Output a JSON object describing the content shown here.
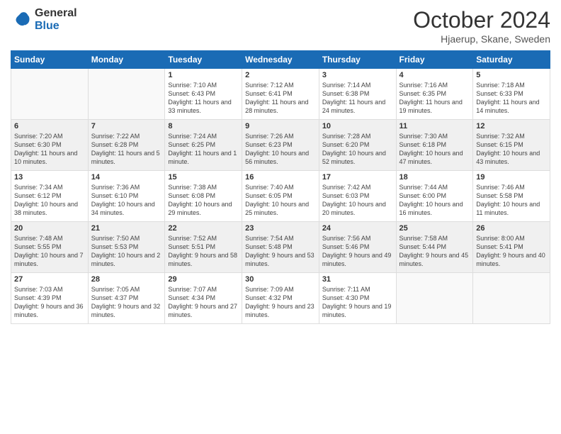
{
  "logo": {
    "general": "General",
    "blue": "Blue"
  },
  "title": "October 2024",
  "location": "Hjaerup, Skane, Sweden",
  "days": [
    "Sunday",
    "Monday",
    "Tuesday",
    "Wednesday",
    "Thursday",
    "Friday",
    "Saturday"
  ],
  "weeks": [
    [
      {
        "day": "",
        "sunrise": "",
        "sunset": "",
        "daylight": ""
      },
      {
        "day": "",
        "sunrise": "",
        "sunset": "",
        "daylight": ""
      },
      {
        "day": "1",
        "sunrise": "Sunrise: 7:10 AM",
        "sunset": "Sunset: 6:43 PM",
        "daylight": "Daylight: 11 hours and 33 minutes."
      },
      {
        "day": "2",
        "sunrise": "Sunrise: 7:12 AM",
        "sunset": "Sunset: 6:41 PM",
        "daylight": "Daylight: 11 hours and 28 minutes."
      },
      {
        "day": "3",
        "sunrise": "Sunrise: 7:14 AM",
        "sunset": "Sunset: 6:38 PM",
        "daylight": "Daylight: 11 hours and 24 minutes."
      },
      {
        "day": "4",
        "sunrise": "Sunrise: 7:16 AM",
        "sunset": "Sunset: 6:35 PM",
        "daylight": "Daylight: 11 hours and 19 minutes."
      },
      {
        "day": "5",
        "sunrise": "Sunrise: 7:18 AM",
        "sunset": "Sunset: 6:33 PM",
        "daylight": "Daylight: 11 hours and 14 minutes."
      }
    ],
    [
      {
        "day": "6",
        "sunrise": "Sunrise: 7:20 AM",
        "sunset": "Sunset: 6:30 PM",
        "daylight": "Daylight: 11 hours and 10 minutes."
      },
      {
        "day": "7",
        "sunrise": "Sunrise: 7:22 AM",
        "sunset": "Sunset: 6:28 PM",
        "daylight": "Daylight: 11 hours and 5 minutes."
      },
      {
        "day": "8",
        "sunrise": "Sunrise: 7:24 AM",
        "sunset": "Sunset: 6:25 PM",
        "daylight": "Daylight: 11 hours and 1 minute."
      },
      {
        "day": "9",
        "sunrise": "Sunrise: 7:26 AM",
        "sunset": "Sunset: 6:23 PM",
        "daylight": "Daylight: 10 hours and 56 minutes."
      },
      {
        "day": "10",
        "sunrise": "Sunrise: 7:28 AM",
        "sunset": "Sunset: 6:20 PM",
        "daylight": "Daylight: 10 hours and 52 minutes."
      },
      {
        "day": "11",
        "sunrise": "Sunrise: 7:30 AM",
        "sunset": "Sunset: 6:18 PM",
        "daylight": "Daylight: 10 hours and 47 minutes."
      },
      {
        "day": "12",
        "sunrise": "Sunrise: 7:32 AM",
        "sunset": "Sunset: 6:15 PM",
        "daylight": "Daylight: 10 hours and 43 minutes."
      }
    ],
    [
      {
        "day": "13",
        "sunrise": "Sunrise: 7:34 AM",
        "sunset": "Sunset: 6:12 PM",
        "daylight": "Daylight: 10 hours and 38 minutes."
      },
      {
        "day": "14",
        "sunrise": "Sunrise: 7:36 AM",
        "sunset": "Sunset: 6:10 PM",
        "daylight": "Daylight: 10 hours and 34 minutes."
      },
      {
        "day": "15",
        "sunrise": "Sunrise: 7:38 AM",
        "sunset": "Sunset: 6:08 PM",
        "daylight": "Daylight: 10 hours and 29 minutes."
      },
      {
        "day": "16",
        "sunrise": "Sunrise: 7:40 AM",
        "sunset": "Sunset: 6:05 PM",
        "daylight": "Daylight: 10 hours and 25 minutes."
      },
      {
        "day": "17",
        "sunrise": "Sunrise: 7:42 AM",
        "sunset": "Sunset: 6:03 PM",
        "daylight": "Daylight: 10 hours and 20 minutes."
      },
      {
        "day": "18",
        "sunrise": "Sunrise: 7:44 AM",
        "sunset": "Sunset: 6:00 PM",
        "daylight": "Daylight: 10 hours and 16 minutes."
      },
      {
        "day": "19",
        "sunrise": "Sunrise: 7:46 AM",
        "sunset": "Sunset: 5:58 PM",
        "daylight": "Daylight: 10 hours and 11 minutes."
      }
    ],
    [
      {
        "day": "20",
        "sunrise": "Sunrise: 7:48 AM",
        "sunset": "Sunset: 5:55 PM",
        "daylight": "Daylight: 10 hours and 7 minutes."
      },
      {
        "day": "21",
        "sunrise": "Sunrise: 7:50 AM",
        "sunset": "Sunset: 5:53 PM",
        "daylight": "Daylight: 10 hours and 2 minutes."
      },
      {
        "day": "22",
        "sunrise": "Sunrise: 7:52 AM",
        "sunset": "Sunset: 5:51 PM",
        "daylight": "Daylight: 9 hours and 58 minutes."
      },
      {
        "day": "23",
        "sunrise": "Sunrise: 7:54 AM",
        "sunset": "Sunset: 5:48 PM",
        "daylight": "Daylight: 9 hours and 53 minutes."
      },
      {
        "day": "24",
        "sunrise": "Sunrise: 7:56 AM",
        "sunset": "Sunset: 5:46 PM",
        "daylight": "Daylight: 9 hours and 49 minutes."
      },
      {
        "day": "25",
        "sunrise": "Sunrise: 7:58 AM",
        "sunset": "Sunset: 5:44 PM",
        "daylight": "Daylight: 9 hours and 45 minutes."
      },
      {
        "day": "26",
        "sunrise": "Sunrise: 8:00 AM",
        "sunset": "Sunset: 5:41 PM",
        "daylight": "Daylight: 9 hours and 40 minutes."
      }
    ],
    [
      {
        "day": "27",
        "sunrise": "Sunrise: 7:03 AM",
        "sunset": "Sunset: 4:39 PM",
        "daylight": "Daylight: 9 hours and 36 minutes."
      },
      {
        "day": "28",
        "sunrise": "Sunrise: 7:05 AM",
        "sunset": "Sunset: 4:37 PM",
        "daylight": "Daylight: 9 hours and 32 minutes."
      },
      {
        "day": "29",
        "sunrise": "Sunrise: 7:07 AM",
        "sunset": "Sunset: 4:34 PM",
        "daylight": "Daylight: 9 hours and 27 minutes."
      },
      {
        "day": "30",
        "sunrise": "Sunrise: 7:09 AM",
        "sunset": "Sunset: 4:32 PM",
        "daylight": "Daylight: 9 hours and 23 minutes."
      },
      {
        "day": "31",
        "sunrise": "Sunrise: 7:11 AM",
        "sunset": "Sunset: 4:30 PM",
        "daylight": "Daylight: 9 hours and 19 minutes."
      },
      {
        "day": "",
        "sunrise": "",
        "sunset": "",
        "daylight": ""
      },
      {
        "day": "",
        "sunrise": "",
        "sunset": "",
        "daylight": ""
      }
    ]
  ]
}
